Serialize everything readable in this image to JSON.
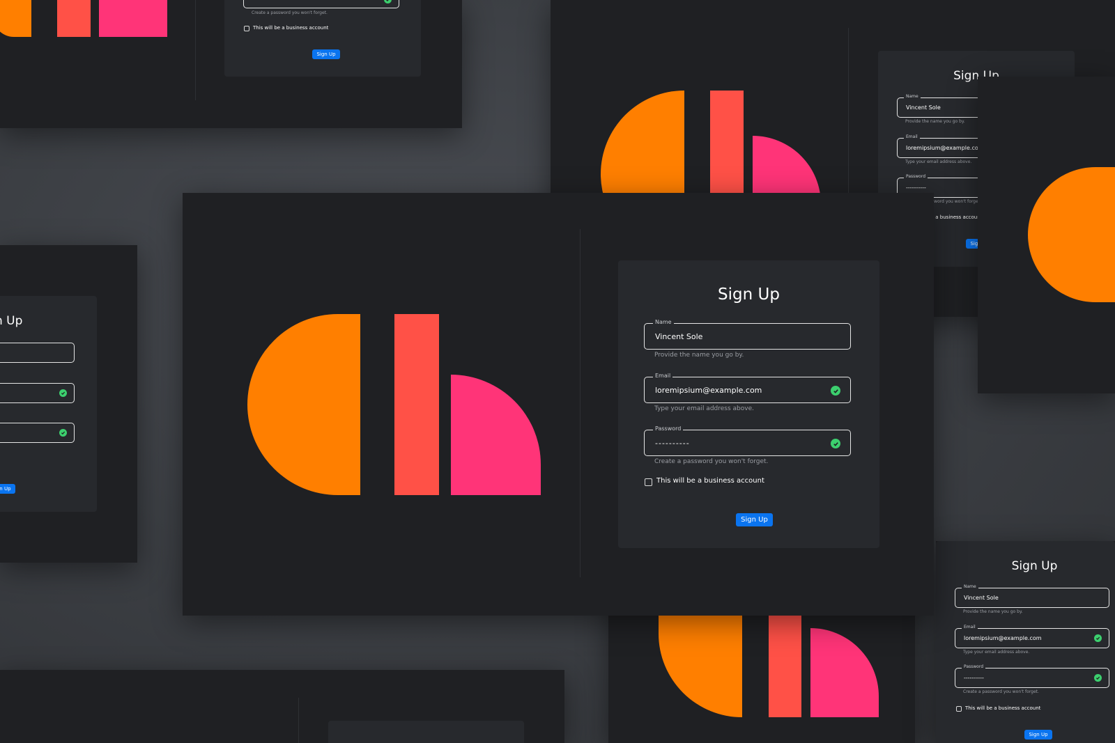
{
  "signup": {
    "title": "Sign Up",
    "name_label": "Name",
    "name_value": "Vincent Sole",
    "name_helper": "Provide the name you go by.",
    "email_label": "Email",
    "email_value": "loremipsium@example.com",
    "email_helper": "Type your email address above.",
    "password_label": "Password",
    "password_value": "----------",
    "password_helper": "Create a password you won't forget.",
    "business_checkbox_label": "This will be a business account",
    "submit_label": "Sign Up"
  },
  "colors": {
    "background": "#3d4045",
    "screen": "#1f2023",
    "card": "#27292d",
    "button": "#0a74f0",
    "check": "#3ccf6e",
    "logo_orange": "#ff7f00",
    "logo_red": "#ff5147",
    "logo_pink": "#ff3478"
  },
  "icons": [
    "check-circle-icon",
    "checkbox-icon"
  ],
  "logo": "orange-half-circle-red-bar-pink-quarter-logo"
}
